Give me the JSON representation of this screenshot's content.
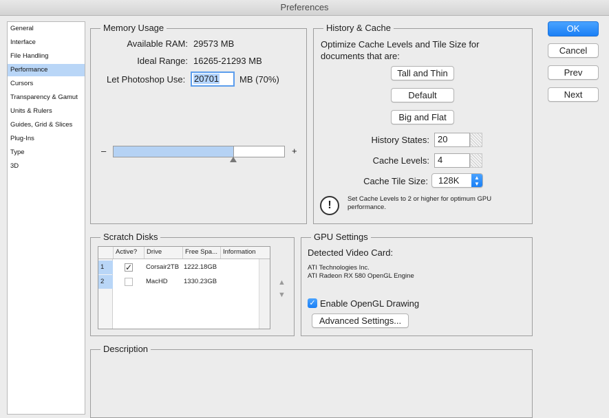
{
  "window": {
    "title": "Preferences"
  },
  "sidebar": {
    "items": [
      {
        "label": "General"
      },
      {
        "label": "Interface"
      },
      {
        "label": "File Handling"
      },
      {
        "label": "Performance"
      },
      {
        "label": "Cursors"
      },
      {
        "label": "Transparency & Gamut"
      },
      {
        "label": "Units & Rulers"
      },
      {
        "label": "Guides, Grid & Slices"
      },
      {
        "label": "Plug-Ins"
      },
      {
        "label": "Type"
      },
      {
        "label": "3D"
      }
    ],
    "selected": "Performance"
  },
  "memory": {
    "legend": "Memory Usage",
    "available_label": "Available RAM:",
    "available_value": "29573 MB",
    "ideal_label": "Ideal Range:",
    "ideal_value": "16265-21293 MB",
    "use_label": "Let Photoshop Use:",
    "use_value": "20701",
    "use_unit": "MB (70%)",
    "slider_min": "–",
    "slider_max": "+",
    "slider_fraction": 0.7
  },
  "history": {
    "legend": "History & Cache",
    "desc": "Optimize Cache Levels and Tile Size for documents that are:",
    "btn_tall": "Tall and Thin",
    "btn_default": "Default",
    "btn_big": "Big and Flat",
    "states_label": "History States:",
    "states_value": "20",
    "levels_label": "Cache Levels:",
    "levels_value": "4",
    "tile_label": "Cache Tile Size:",
    "tile_value": "128K",
    "warning": "Set Cache Levels to 2 or higher for optimum GPU performance."
  },
  "scratch": {
    "legend": "Scratch Disks",
    "headers": [
      "Active?",
      "Drive",
      "Free Spa...",
      "Information"
    ],
    "rows": [
      {
        "num": "1",
        "active": true,
        "drive": "Corsair2TB",
        "free": "1222.18GB",
        "info": ""
      },
      {
        "num": "2",
        "active": false,
        "drive": "MacHD",
        "free": "1330.23GB",
        "info": ""
      }
    ]
  },
  "gpu": {
    "legend": "GPU Settings",
    "detected": "Detected Video Card:",
    "vendor": "ATI Technologies Inc.",
    "card": "ATI Radeon RX 580 OpenGL Engine",
    "opengl_label": "Enable OpenGL Drawing",
    "opengl_checked": true,
    "advanced": "Advanced Settings..."
  },
  "description": {
    "legend": "Description"
  },
  "actions": {
    "ok": "OK",
    "cancel": "Cancel",
    "prev": "Prev",
    "next": "Next"
  },
  "colors": {
    "accent": "#1a7ff5",
    "selection": "#b9d6f7"
  }
}
